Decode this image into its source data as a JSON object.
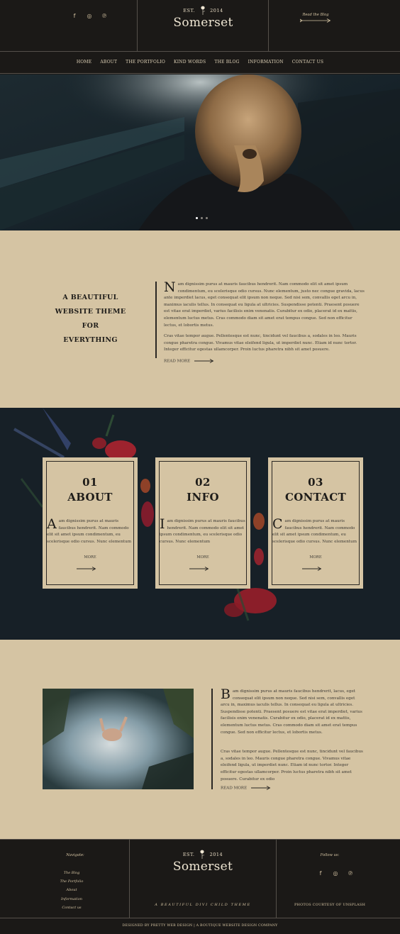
{
  "header": {
    "social_icons": [
      "facebook-icon",
      "instagram-icon",
      "pinterest-icon"
    ],
    "social_glyphs": [
      "f",
      "◎",
      "℗"
    ],
    "logo": {
      "est": "EST.",
      "year": "2014",
      "name": "Somerset"
    },
    "read_blog": "Read the Blog"
  },
  "nav": {
    "items": [
      "HOME",
      "ABOUT",
      "THE PORTFOLIO",
      "KIND WORDS",
      "THE BLOG",
      "INFORMATION",
      "CONTACT US"
    ]
  },
  "hero": {
    "slide_count": 3,
    "active_slide": 1
  },
  "intro": {
    "heading_lines": [
      "A BEAUTIFUL",
      "WEBSITE THEME",
      "FOR",
      "EVERYTHING"
    ],
    "dropcap": "N",
    "paragraph1": "am dignissim purus at mauris faucibus hendrerit. Nam commodo elit sit amet ipsum condimentum, eu scelerisque odio cursus. Nunc elementum, justo nec congue gravida, lacus ante imperdiet lacus, eget consequat elit ipsum non neque. Sed nisi sem, convallis eget arcu in, maximus iaculis tellus. In consequat eu ligula at ultricies. Suspendisse potenti. Praesent posuere est vitae erat imperdiet, varius facilisis enim venenatis. Curabitur ex odio, placerat id ex mattis, elementum luctus metus. Cras commodo diam sit amet erat tempus congue. Sed non efficitur lectus, et lobortis metus.",
    "paragraph2": "Cras vitae tempor augue. Pellentesque est nunc, tincidunt vel faucibus a, sodales in leo. Mauris congue pharetra congue. Vivamus vitae eleifend ligula, ut imperdiet nunc. Etiam id nunc tortor. Integer efficitur egestas ullamcorper. Proin luctus pharetra nibh sit amet posuere.",
    "read_more": "READ MORE"
  },
  "cards": [
    {
      "num": "01",
      "title": "ABOUT",
      "dropcap": "A",
      "text": "am dignissim purus at mauris faucibus hendrerit. Nam commodo elit sit amet ipsum condimentum, eu scelerisque odio cursus. Nunc elementum",
      "more": "MORE"
    },
    {
      "num": "02",
      "title": "INFO",
      "dropcap": "I",
      "text": "am dignissim purus at mauris faucibus hendrerit. Nam commodo elit sit amet ipsum condimentum, eu scelerisque odio cursus. Nunc elementum",
      "more": "MORE"
    },
    {
      "num": "03",
      "title": "CONTACT",
      "dropcap": "C",
      "text": "am dignissim purus at mauris faucibus hendrerit. Nam commodo elit sit amet ipsum condimentum, eu scelerisque odio cursus. Nunc elementum",
      "more": "MORE"
    }
  ],
  "feature": {
    "dropcap": "B",
    "paragraph1": "am dignissim purus at mauris faucibus hendrerit, lacus, eget consequat elit ipsum non neque. Sed nisi sem, convallis eget arcu in, maximus iaculis tellus. In consequat eu ligula at ultricies. Suspendisse potenti. Praesent posuere est vitae erat imperdiet, varius facilisis enim venenatis. Curabitur ex odio, placerat id ex mattis, elementum luctus metus. Cras commodo diam sit amet erat tempus congue. Sed non efficitur lectus, et lobortis metus.",
    "paragraph2": "Cras vitae tempor augue. Pellentesque est nunc, tincidunt vel faucibus a, sodales in leo. Mauris congue pharetra congue. Vivamus vitae eleifend ligula, ut imperdiet nunc. Etiam id nunc tortor. Integer efficitur egestas ullamcorper. Proin luctus pharetra nibh sit amet posuere. Curabitur ex odio",
    "read_more": "READ MORE"
  },
  "footer": {
    "navigate_title": "Navigate:",
    "links": [
      "The Blog",
      "The Portfolio",
      "About",
      "Information",
      "Contact us"
    ],
    "logo": {
      "est": "EST.",
      "year": "2014",
      "name": "Somerset"
    },
    "tagline": "A BEAUTIFUL DIVI CHILD THEME",
    "follow_title": "Follow us:",
    "social_glyphs": [
      "f",
      "◎",
      "℗"
    ],
    "photo_credit": "PHOTOS COURTESY OF UNSPLASH",
    "bottom": "DESIGNED BY PRETTY WEB DESIGN | A BOUTIQUE WEBSITE DESIGN COMPANY"
  },
  "colors": {
    "dark": "#1b1917",
    "tan": "#d5c4a3",
    "line": "#55504a",
    "text": "#3d3a35"
  }
}
